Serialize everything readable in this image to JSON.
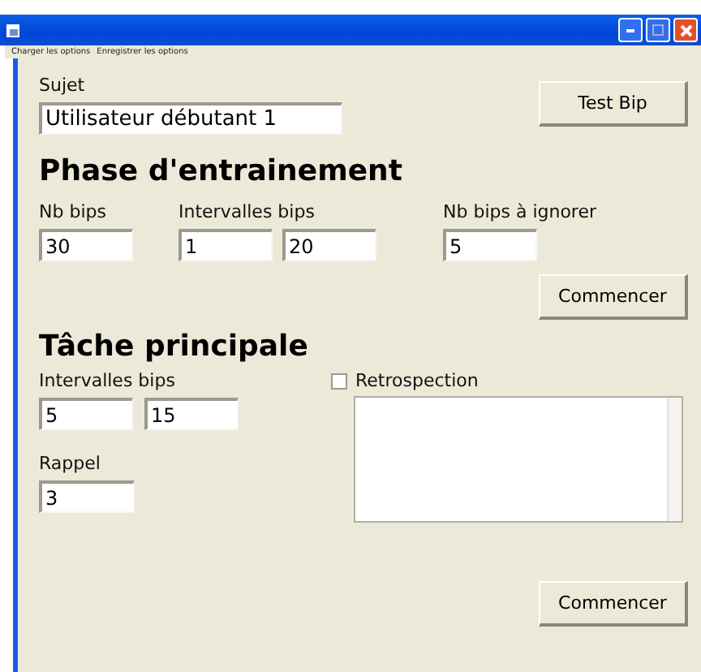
{
  "menu": [
    "Charger les options",
    "Enregistrer les options"
  ],
  "subject": {
    "label": "Sujet",
    "value": "Utilisateur débutant 1"
  },
  "test_button": "Test Bip",
  "training": {
    "title": "Phase d'entrainement",
    "nb_bips": {
      "label": "Nb bips",
      "value": "30"
    },
    "intervals": {
      "label": "Intervalles bips",
      "values": [
        "1",
        "20"
      ]
    },
    "ignore": {
      "label": "Nb bips à ignorer",
      "value": "5"
    },
    "start_button": "Commencer"
  },
  "main_task": {
    "title": "Tâche principale",
    "intervals": {
      "label": "Intervalles bips",
      "values": [
        "5",
        "15"
      ]
    },
    "recall": {
      "label": "Rappel",
      "value": "3"
    },
    "retrospection": {
      "label": "Retrospection",
      "checked": false
    },
    "start_button": "Commencer"
  }
}
